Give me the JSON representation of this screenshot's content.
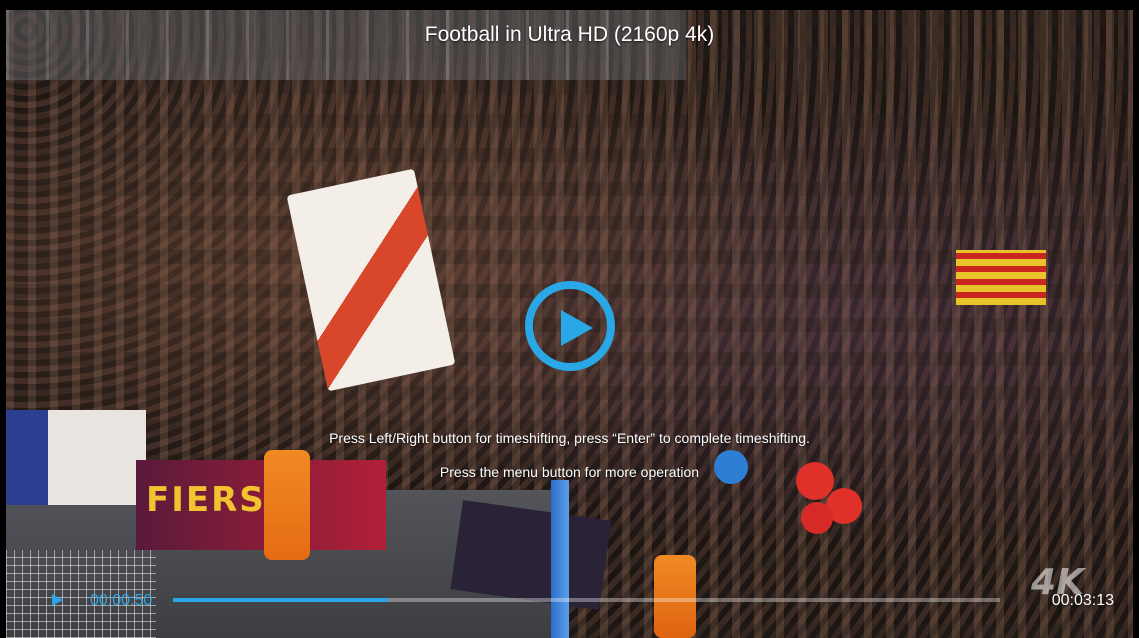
{
  "video": {
    "title": "Football in Ultra HD (2160p 4k)"
  },
  "overlay": {
    "hint_timeshift": "Press Left/Right button for timeshifting, press “Enter” to complete timeshifting.",
    "hint_menu": "Press the menu button for more operation"
  },
  "player": {
    "current_time": "00:00:50",
    "total_time": "00:03:13",
    "progress": 0.26,
    "play_icon": "play-icon",
    "accent_color": "#2aa7e6"
  },
  "scene": {
    "banner_text": "FIERS",
    "watermark": "4K"
  }
}
